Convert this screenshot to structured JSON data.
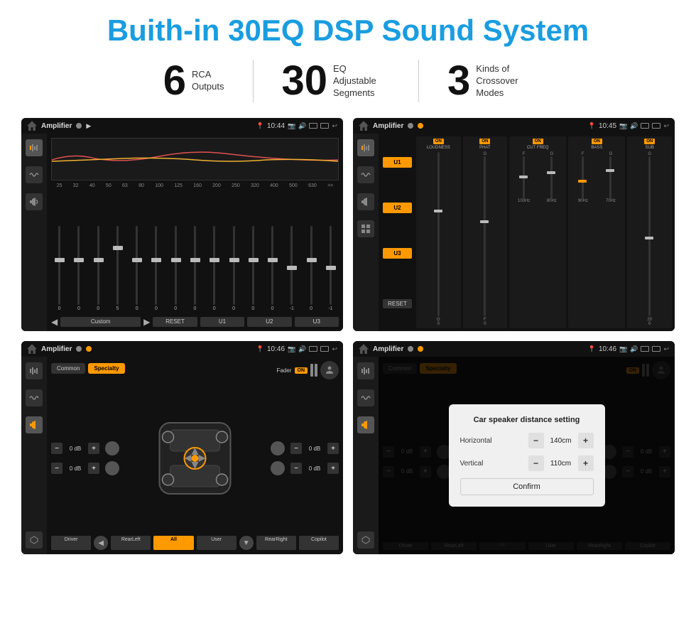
{
  "title": "Buith-in 30EQ DSP Sound System",
  "stats": [
    {
      "number": "6",
      "label": "RCA\nOutputs"
    },
    {
      "number": "30",
      "label": "EQ Adjustable\nSegments"
    },
    {
      "number": "3",
      "label": "Kinds of\nCrossover Modes"
    }
  ],
  "screens": [
    {
      "id": "screen1",
      "statusBar": {
        "appName": "Amplifier",
        "time": "10:44"
      },
      "type": "eq"
    },
    {
      "id": "screen2",
      "statusBar": {
        "appName": "Amplifier",
        "time": "10:45"
      },
      "type": "amp2"
    },
    {
      "id": "screen3",
      "statusBar": {
        "appName": "Amplifier",
        "time": "10:46"
      },
      "type": "fader"
    },
    {
      "id": "screen4",
      "statusBar": {
        "appName": "Amplifier",
        "time": "10:46"
      },
      "type": "dialog"
    }
  ],
  "eqFreqs": [
    "25",
    "32",
    "40",
    "50",
    "63",
    "80",
    "100",
    "125",
    "160",
    "200",
    "250",
    "320",
    "400",
    "500",
    "630"
  ],
  "eqValues": [
    "0",
    "0",
    "0",
    "5",
    "0",
    "0",
    "0",
    "0",
    "0",
    "0",
    "0",
    "0",
    "-1",
    "0",
    "-1"
  ],
  "eqMode": "Custom",
  "eqButtons": [
    "RESET",
    "U1",
    "U2",
    "U3"
  ],
  "amp2Channels": [
    {
      "label": "LOUDNESS",
      "on": true,
      "sliderPos": 60
    },
    {
      "label": "PHAT",
      "on": true,
      "sliderPos": 50
    },
    {
      "label": "CUT FREQ",
      "on": true,
      "sliderPos": 40
    },
    {
      "label": "BASS",
      "on": true,
      "sliderPos": 55
    },
    {
      "label": "SUB",
      "on": true,
      "sliderPos": 45
    }
  ],
  "uButtons": [
    "U1",
    "U2",
    "U3"
  ],
  "resetLabel": "RESET",
  "faderScreen": {
    "tabs": [
      "Common",
      "Specialty"
    ],
    "activeTab": "Specialty",
    "faderLabel": "Fader",
    "faderOn": "ON",
    "volControls": [
      {
        "value": "0 dB",
        "pos": "top-left"
      },
      {
        "value": "0 dB",
        "pos": "top-right"
      },
      {
        "value": "0 dB",
        "pos": "bot-left"
      },
      {
        "value": "0 dB",
        "pos": "bot-right"
      }
    ],
    "bottomButtons": [
      "Driver",
      "RearLeft",
      "All",
      "User",
      "RearRight",
      "Copilot"
    ]
  },
  "dialog": {
    "title": "Car speaker distance setting",
    "fields": [
      {
        "label": "Horizontal",
        "value": "140cm"
      },
      {
        "label": "Vertical",
        "value": "110cm"
      }
    ],
    "confirmLabel": "Confirm"
  }
}
